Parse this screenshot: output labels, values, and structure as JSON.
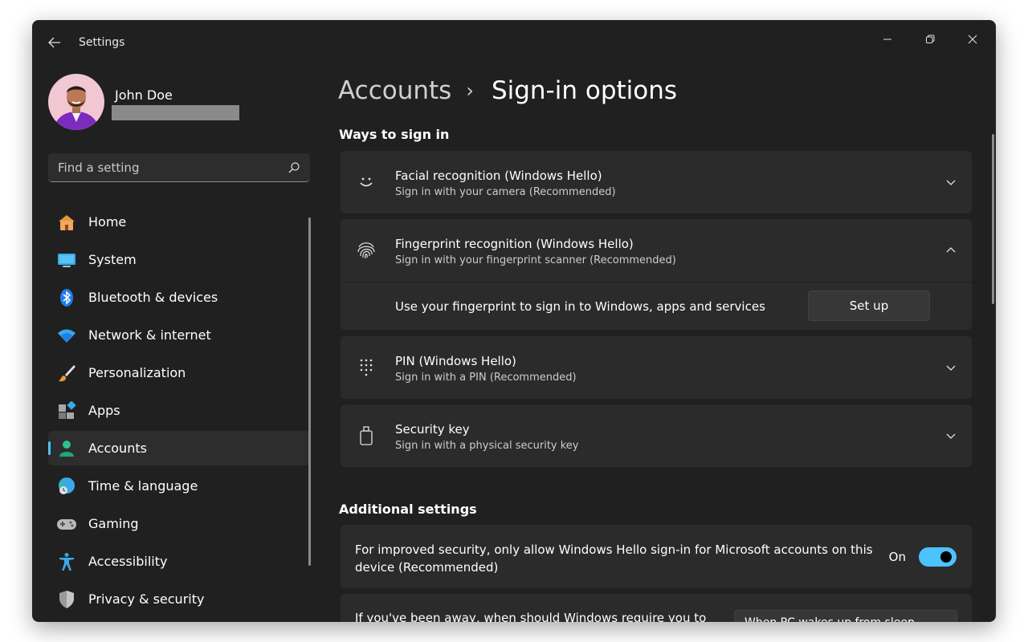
{
  "app": {
    "title": "Settings"
  },
  "user": {
    "name": "John Doe"
  },
  "search": {
    "placeholder": "Find a setting"
  },
  "nav": [
    {
      "label": "Home",
      "icon": "home-icon",
      "active": false
    },
    {
      "label": "System",
      "icon": "system-icon",
      "active": false
    },
    {
      "label": "Bluetooth & devices",
      "icon": "bluetooth-icon",
      "active": false
    },
    {
      "label": "Network & internet",
      "icon": "wifi-icon",
      "active": false
    },
    {
      "label": "Personalization",
      "icon": "brush-icon",
      "active": false
    },
    {
      "label": "Apps",
      "icon": "apps-icon",
      "active": false
    },
    {
      "label": "Accounts",
      "icon": "accounts-icon",
      "active": true
    },
    {
      "label": "Time & language",
      "icon": "globe-clock-icon",
      "active": false
    },
    {
      "label": "Gaming",
      "icon": "gamepad-icon",
      "active": false
    },
    {
      "label": "Accessibility",
      "icon": "accessibility-icon",
      "active": false
    },
    {
      "label": "Privacy & security",
      "icon": "shield-icon",
      "active": false
    }
  ],
  "breadcrumb": {
    "parent": "Accounts",
    "separator": "›",
    "current": "Sign-in options"
  },
  "ways": {
    "title": "Ways to sign in",
    "items": [
      {
        "title": "Facial recognition (Windows Hello)",
        "subtitle": "Sign in with your camera (Recommended)",
        "icon": "face-icon",
        "expanded": false
      },
      {
        "title": "Fingerprint recognition (Windows Hello)",
        "subtitle": "Sign in with your fingerprint scanner (Recommended)",
        "icon": "fingerprint-icon",
        "expanded": true
      },
      {
        "title": "PIN (Windows Hello)",
        "subtitle": "Sign in with a PIN (Recommended)",
        "icon": "pin-keypad-icon",
        "expanded": false
      },
      {
        "title": "Security key",
        "subtitle": "Sign in with a physical security key",
        "icon": "security-key-icon",
        "expanded": false
      }
    ],
    "fingerprint_detail": {
      "text": "Use your fingerprint to sign in to Windows, apps and services",
      "button": "Set up"
    }
  },
  "additional": {
    "title": "Additional settings",
    "hello_only": {
      "text": "For improved security, only allow Windows Hello sign-in for Microsoft accounts on this device (Recommended)",
      "state_label": "On",
      "enabled": true
    },
    "require_signin": {
      "text": "If you've been away, when should Windows require you to",
      "value": "When PC wakes up from sleep"
    }
  },
  "colors": {
    "accent": "#4cc2ff",
    "window_bg": "#202020",
    "card_bg": "#2b2b2b"
  }
}
